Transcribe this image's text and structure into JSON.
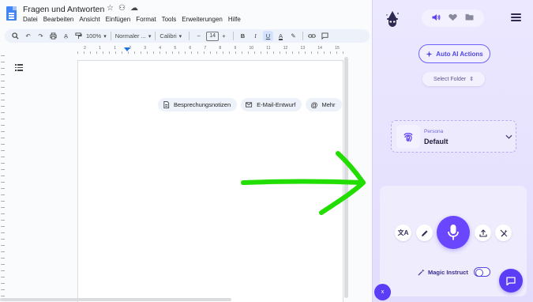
{
  "doc": {
    "title": "Fragen und Antworten",
    "menu": [
      "Datei",
      "Bearbeiten",
      "Ansicht",
      "Einfügen",
      "Format",
      "Tools",
      "Erweiterungen",
      "Hilfe"
    ]
  },
  "toolbar": {
    "zoom": "100%",
    "style": "Normaler ...",
    "font": "Calibri",
    "font_size": "14",
    "bold": "B",
    "italic": "I",
    "underline": "U",
    "text_color": "A"
  },
  "ruler": {
    "marks": [
      "2",
      "1",
      "1",
      "2",
      "3",
      "4",
      "5",
      "6",
      "7",
      "8",
      "9",
      "10",
      "11",
      "12",
      "13",
      "14",
      "15"
    ]
  },
  "chips": {
    "meeting_notes": "Besprechungsnotizen",
    "email_draft": "E-Mail-Entwurf",
    "more": "Mehr"
  },
  "panel": {
    "auto_ai": "Auto AI Actions",
    "select_folder": "Select Folder",
    "persona_label": "Persona",
    "persona_value": "Default",
    "magic_instruct": "Magic Instruct",
    "close": "x"
  },
  "colors": {
    "accent": "#6b46ff",
    "arrow": "#22dd00",
    "docs_blue": "#4285f4"
  }
}
